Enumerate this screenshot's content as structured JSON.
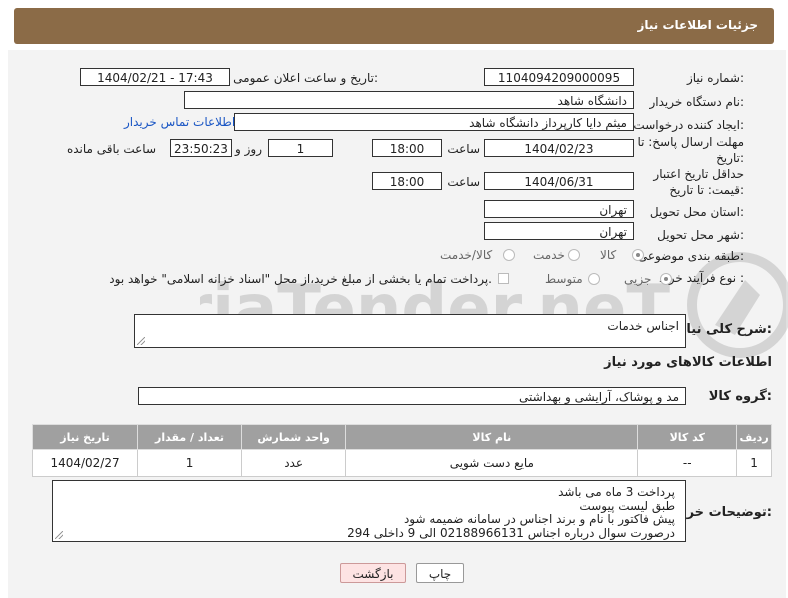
{
  "header": {
    "title": "جزئیات اطلاعات نیاز"
  },
  "fields": {
    "need_number_label": "شماره نیاز:",
    "need_number": "1104094209000095",
    "announce_label": "تاریخ و ساعت اعلان عمومی:",
    "announce_value": "1404/02/21 - 17:43",
    "buyer_org_label": "نام دستگاه خریدار:",
    "buyer_org": "دانشگاه شاهد",
    "requester_label": "ایجاد کننده درخواست:",
    "requester": "میثم دایا کارپرداز دانشگاه شاهد",
    "contact_link": "اطلاعات تماس خریدار",
    "reply_deadline_label": "مهلت ارسال پاسخ: تا تاریخ:",
    "reply_date": "1404/02/23",
    "time_label": "ساعت",
    "reply_time": "18:00",
    "days_value": "1",
    "days_label": "روز و",
    "remaining_time": "23:50:23",
    "remaining_label": "ساعت باقی مانده",
    "validity_label": "حداقل تاریخ اعتبار قیمت: تا تاریخ:",
    "validity_date": "1404/06/31",
    "validity_time": "18:00",
    "province_label": "استان محل تحویل:",
    "province": "تهران",
    "city_label": "شهر محل تحویل:",
    "city": "تهران",
    "category_label": "طبقه بندی موضوعی:",
    "category_options": [
      "کالا",
      "خدمت",
      "کالا/خدمت"
    ],
    "purchase_label": "نوع فرآیند خرید :",
    "purchase_options": [
      "جزیی",
      "متوسط"
    ],
    "payment_note": "پرداخت تمام یا بخشی از مبلغ خرید،از محل \"اسناد خزانه اسلامی\" خواهد بود."
  },
  "description": {
    "label": "شرح کلی نیاز:",
    "value": "اجناس خدمات"
  },
  "goods_section": {
    "title": "اطلاعات کالاهای مورد نیاز",
    "group_label": "گروه کالا:",
    "group_value": "مد و پوشاک، آرایشی و بهداشتی"
  },
  "table": {
    "headers": [
      "ردیف",
      "کد کالا",
      "نام کالا",
      "واحد شمارش",
      "تعداد / مقدار",
      "تاریخ نیاز"
    ],
    "rows": [
      [
        "1",
        "--",
        "مایع دست شویی",
        "عدد",
        "1",
        "1404/02/27"
      ]
    ]
  },
  "buyer_notes": {
    "label": "توضیحات خریدار:",
    "lines": [
      "پرداخت 3 ماه می باشد",
      "طبق لیست پیوست",
      "پیش فاکتور با نام و برند اجناس در سامانه ضمیمه شود",
      "درصورت سوال درباره اجناس 02188966131 الی 9 داخلی 294"
    ]
  },
  "buttons": {
    "print": "چاپ",
    "back": "بازگشت"
  },
  "watermark": "AriaTender.neT"
}
